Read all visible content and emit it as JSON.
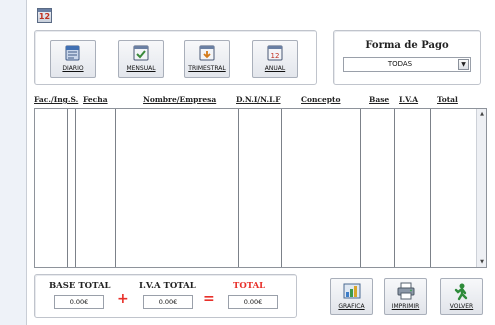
{
  "app_icon": {
    "name": "calendar-icon",
    "text": "12"
  },
  "period_buttons": [
    {
      "label": "DIARIO",
      "icon": "daily-calendar-icon"
    },
    {
      "label": "MENSUAL",
      "icon": "monthly-calendar-icon"
    },
    {
      "label": "TRIMESTRAL",
      "icon": "quarterly-calendar-icon"
    },
    {
      "label": "ANUAL",
      "icon": "yearly-calendar-icon"
    }
  ],
  "payment": {
    "title": "Forma de Pago",
    "selected": "TODAS"
  },
  "table": {
    "columns": [
      "Fac./Ing.S.",
      "Fecha",
      "Nombre/Empresa",
      "D.N.I/N.I.F",
      "Concepto",
      "Base",
      "I.V.A",
      "Total"
    ],
    "rows": []
  },
  "totals": {
    "base_label": "BASE TOTAL",
    "base_value": "0.00€",
    "iva_label": "I.V.A TOTAL",
    "iva_value": "0.00€",
    "total_label": "TOTAL",
    "total_value": "0.00€",
    "plus": "+",
    "equals": "="
  },
  "actions": [
    {
      "label": "GRAFICA",
      "icon": "chart-icon"
    },
    {
      "label": "IMPRIMIR",
      "icon": "printer-icon"
    },
    {
      "label": "VOLVER",
      "icon": "back-icon"
    }
  ],
  "colors": {
    "total_accent": "#e8302a",
    "border": "#8e939b"
  }
}
